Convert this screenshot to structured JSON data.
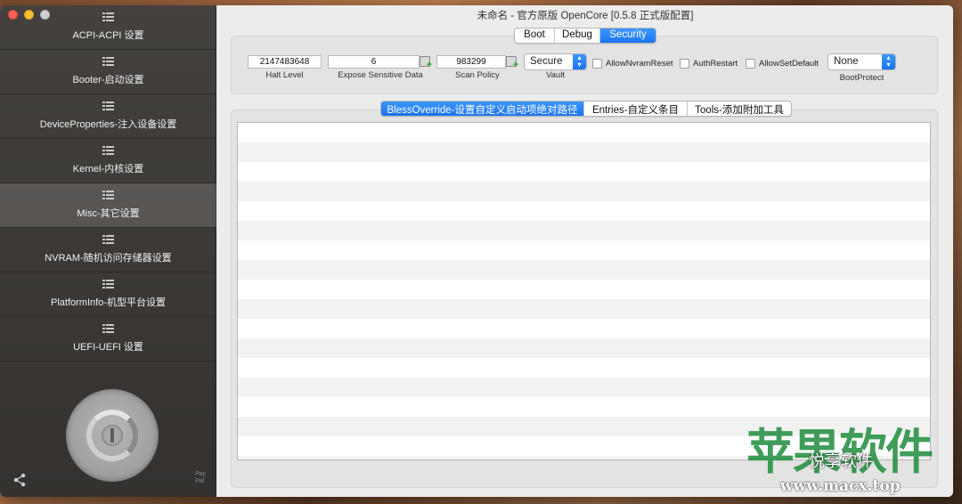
{
  "window": {
    "title": "未命名 - 官方原版 OpenCore [0.5.8 正式版配置]"
  },
  "sidebar": {
    "items": [
      {
        "label": "ACPI-ACPI 设置"
      },
      {
        "label": "Booter-启动设置"
      },
      {
        "label": "DeviceProperties-注入设备设置"
      },
      {
        "label": "Kernel-内核设置"
      },
      {
        "label": "Misc-其它设置",
        "active": true
      },
      {
        "label": "NVRAM-随机访问存储器设置"
      },
      {
        "label": "PlatformInfo-机型平台设置"
      },
      {
        "label": "UEFI-UEFI 设置"
      }
    ],
    "paypal": "PayPal"
  },
  "top_tabs": [
    {
      "label": "Boot"
    },
    {
      "label": "Debug"
    },
    {
      "label": "Security",
      "selected": true
    }
  ],
  "security": {
    "halt_level": {
      "value": "2147483648",
      "label": "Halt Level"
    },
    "expose_sensitive_data": {
      "value": "6",
      "label": "Expose Sensitive Data"
    },
    "scan_policy": {
      "value": "983299",
      "label": "Scan Policy"
    },
    "vault": {
      "value": "Secure",
      "label": "Vault"
    },
    "checkboxes": [
      {
        "label": "AllowNvramReset",
        "checked": false
      },
      {
        "label": "AuthRestart",
        "checked": false
      },
      {
        "label": "AllowSetDefault",
        "checked": false
      }
    ],
    "boot_protect": {
      "value": "None",
      "label": "BootProtect"
    }
  },
  "mid_tabs": [
    {
      "label": "BlessOverride-设置自定义启动项绝对路径",
      "selected": true
    },
    {
      "label": "Entries-自定义条目"
    },
    {
      "label": "Tools-添加附加工具"
    }
  ],
  "watermark": {
    "big": "苹果软件",
    "small": "悦享软件",
    "url": "www.macx.top"
  }
}
